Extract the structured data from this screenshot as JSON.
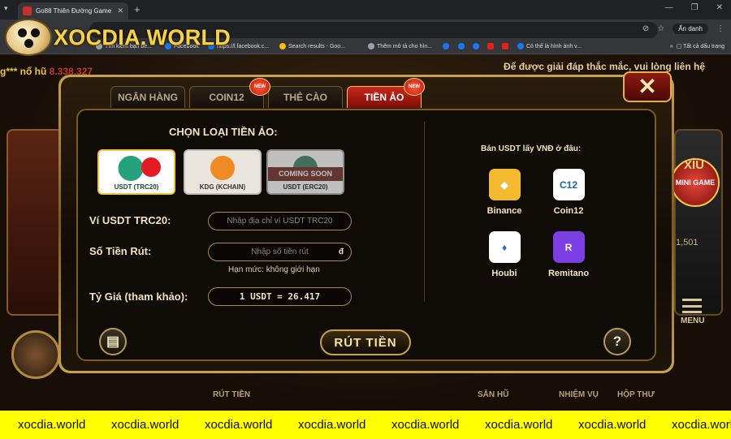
{
  "browser": {
    "tab_title": "Go88 Thiên Đường Game",
    "bookmarks": [
      "Tìm kiếm bạn bè...",
      "Facebook",
      "https://l.facebook.c...",
      "Search results - Goo...",
      "Thêm mô tả cho hìn...",
      "Có thể là hình ảnh v..."
    ],
    "incognito_label": "Ẩn danh",
    "all_bookmarks": "Tất cả dấu trang"
  },
  "logo": {
    "text": "XOCDIA.WORLD"
  },
  "game": {
    "ticker_left_user": "g*** nổ hũ",
    "ticker_left_amount": "8.338.327",
    "ticker_right": "Để được giải đáp thắc mắc, vui lòng liên hệ",
    "minigame_label": "MINI GAME",
    "xiu_label": "XỈU",
    "side_number": "1,501",
    "bottom_nav": [
      "RÚT TIỀN",
      "SĂN HŨ",
      "NHIỆM VỤ",
      "HỘP THƯ",
      "MENU"
    ]
  },
  "modal": {
    "tabs": [
      {
        "label": "NGÂN HÀNG",
        "new": false,
        "active": false
      },
      {
        "label": "COIN12",
        "new": true,
        "active": false
      },
      {
        "label": "THẺ CÀO",
        "new": false,
        "active": false
      },
      {
        "label": "TIỀN ẢO",
        "new": true,
        "active": true
      }
    ],
    "new_badge_label": "NEW",
    "choose_title": "CHỌN LOẠI TIỀN ẢO:",
    "coins": [
      {
        "label": "USDT (TRC20)",
        "selected": true
      },
      {
        "label": "KDG (KCHAIN)",
        "selected": false
      },
      {
        "label": "USDT (ERC20)",
        "selected": false,
        "banner": "COMING SOON"
      }
    ],
    "wallet_label": "Ví USDT TRC20:",
    "wallet_placeholder": "Nhập địa chỉ ví USDT TRC20",
    "amount_label": "Số Tiền Rút:",
    "amount_placeholder": "Nhập số tiền rút",
    "amount_unit": "đ",
    "limit_text": "Hạn mức: không giới hạn",
    "rate_label": "Tỷ Giá (tham khảo):",
    "rate_value": "1 USDT = 26.417",
    "sell_title": "Bán USDT lấy VNĐ ở đâu:",
    "exchanges": [
      {
        "name": "Binance",
        "color": "#f3ba2f"
      },
      {
        "name": "Coin12",
        "color": "#ffffff"
      },
      {
        "name": "Houbi",
        "color": "#ffffff"
      },
      {
        "name": "Remitano",
        "color": "#7b3fe4"
      }
    ],
    "withdraw_label": "RÚT TIỀN",
    "help_icon": "?"
  },
  "watermark": [
    "xocdia.world",
    "xocdia.world",
    "xocdia.world",
    "xocdia.world",
    "xocdia.world",
    "xocdia.world",
    "xocdia.world",
    "xocdia.world"
  ]
}
